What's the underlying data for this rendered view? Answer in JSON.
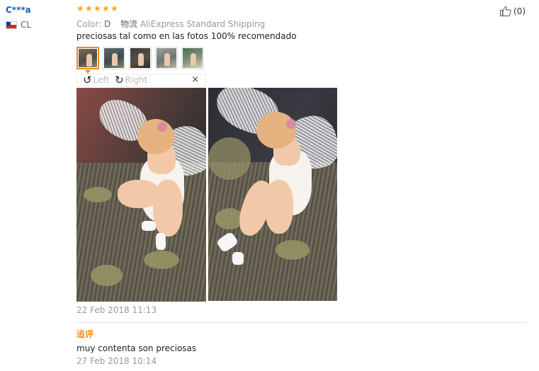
{
  "reviewer": {
    "name": "C***a",
    "country_code": "CL"
  },
  "rating": {
    "stars": 5,
    "max": 5,
    "color": "#f5a623"
  },
  "helpful": {
    "count_label": "(0)",
    "icon": "thumbs-up-icon"
  },
  "order_meta": {
    "color_label": "Color:",
    "color_value": "D",
    "shipping_label": "物流",
    "shipping_value": "AliExpress Standard Shipping"
  },
  "review": {
    "text": "preciosas tal como en las fotos 100% recomendado",
    "date": "22 Feb 2018 11:13"
  },
  "gallery": {
    "thumbnail_count": 5,
    "selected_index": 0,
    "rotate_left_label": "Left",
    "rotate_right_label": "Right",
    "close_label": "×"
  },
  "additional": {
    "label": "追评",
    "text": "muy contenta son preciosas",
    "date": "27 Feb 2018 10:14"
  },
  "colors": {
    "accent": "#f08c1d",
    "link": "#1a5fb4",
    "muted": "#999999"
  }
}
